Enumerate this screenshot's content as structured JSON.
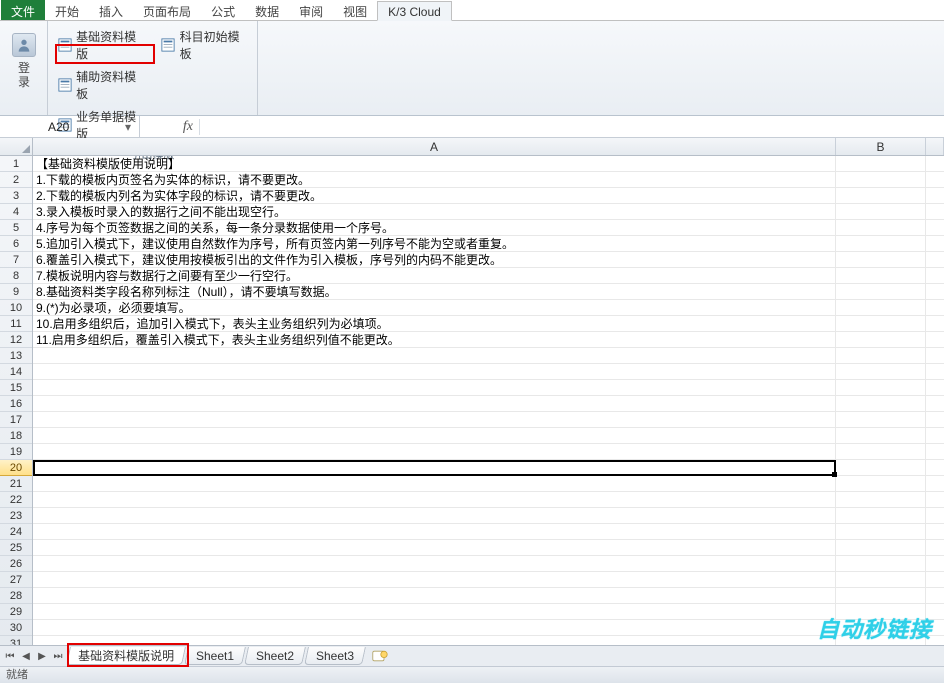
{
  "tabs": {
    "file": "文件",
    "start": "开始",
    "insert": "插入",
    "layout": "页面布局",
    "formula": "公式",
    "data": "数据",
    "review": "审阅",
    "view": "视图",
    "k3": "K/3 Cloud"
  },
  "ribbon": {
    "login_label": "登\n录",
    "group1_label": "",
    "cmd_basic_template": "基础资料模版",
    "cmd_subject_init": "科目初始模板",
    "cmd_aux_template": "辅助资料模板",
    "cmd_biz_template": "业务单据模版",
    "group2_label": "引出模版"
  },
  "fx": {
    "namebox": "A20",
    "fx_label": "fx",
    "formula": ""
  },
  "columns": {
    "A": "A",
    "B": "B"
  },
  "rows": [
    "【基础资料模版使用说明】",
    "1.下载的模板内页签名为实体的标识，请不要更改。",
    "2.下载的模板内列名为实体字段的标识，请不要更改。",
    "3.录入模板时录入的数据行之间不能出现空行。",
    "4.序号为每个页签数据之间的关系，每一条分录数据使用一个序号。",
    "5.追加引入模式下，建议使用自然数作为序号，所有页签内第一列序号不能为空或者重复。",
    "6.覆盖引入模式下，建议使用按模板引出的文件作为引入模板，序号列的内码不能更改。",
    "7.模板说明内容与数据行之间要有至少一行空行。",
    "8.基础资料类字段名称列标注（Null），请不要填写数据。",
    "9.(*)为必录项，必须要填写。",
    "10.启用多组织后，追加引入模式下，表头主业务组织列为必填项。",
    "11.启用多组织后，覆盖引入模式下，表头主业务组织列值不能更改。"
  ],
  "row_numbers": [
    "1",
    "2",
    "3",
    "4",
    "5",
    "6",
    "7",
    "8",
    "9",
    "10",
    "11",
    "12",
    "13",
    "14",
    "15",
    "16",
    "17",
    "18",
    "19",
    "20",
    "21",
    "22",
    "23",
    "24",
    "25",
    "26",
    "27",
    "28",
    "29",
    "30",
    "31"
  ],
  "sheet_tabs": {
    "t1": "基础资料模版说明",
    "t2": "Sheet1",
    "t3": "Sheet2",
    "t4": "Sheet3"
  },
  "status": "就绪",
  "watermark": "自动秒链接",
  "chart_data": null
}
